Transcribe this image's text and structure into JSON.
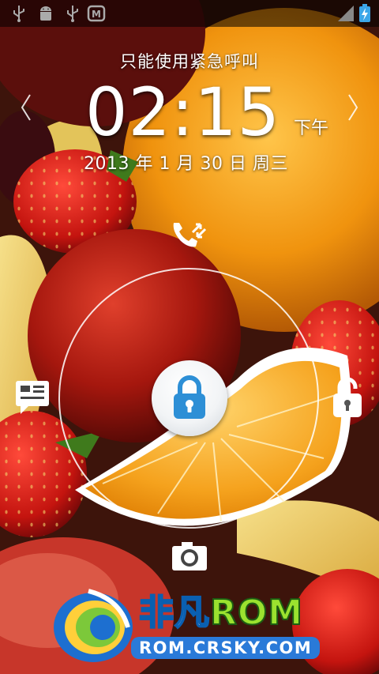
{
  "status_bar": {
    "icons_left": [
      "usb-icon",
      "android-debug-icon",
      "usb-icon",
      "market-icon"
    ],
    "icons_right": [
      "signal-icon",
      "battery-charging-icon"
    ]
  },
  "lockscreen": {
    "emergency_text": "只能使用紧急呼叫",
    "time": "02:15",
    "ampm": "下午",
    "date": "2013 年 1 月 30 日 周三",
    "targets": {
      "top": "call-icon",
      "left": "message-icon",
      "right": "unlock-icon",
      "bottom": "camera-icon",
      "center": "lock-icon"
    }
  },
  "watermark": {
    "title_part1": "非凡",
    "title_part2": "ROM",
    "url": "ROM.CRSKY.COM"
  },
  "colors": {
    "lock_blue": "#2d8fd6",
    "ring": "#ffffff"
  }
}
